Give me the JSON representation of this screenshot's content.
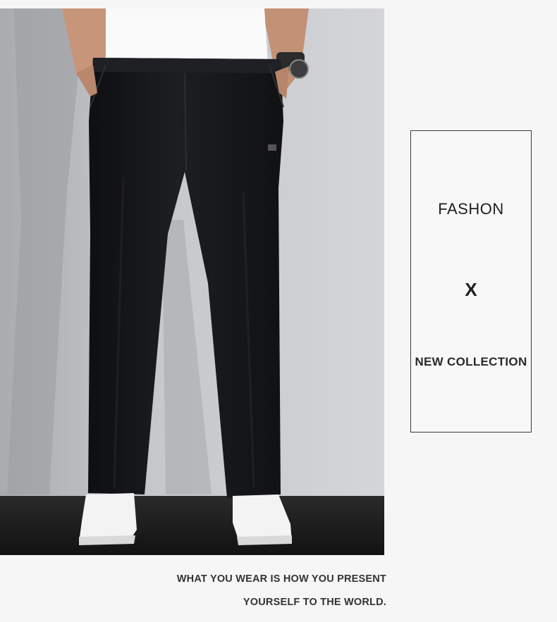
{
  "caption": {
    "word1": "FASHON",
    "separator": "X",
    "word2": "NEW COLLECTION"
  },
  "tagline": {
    "line1": "WHAT YOU WEAR IS HOW YOU PRESENT",
    "line2": "YOURSELF TO THE WORLD."
  },
  "colors": {
    "page_background": "#f6f6f6",
    "studio_wall": "#c8c9cc",
    "studio_floor": "#1c1c1c",
    "pants": "#141517",
    "shirt": "#fafafa",
    "sneakers": "#f2f2f2",
    "skin": "#c9977a"
  }
}
